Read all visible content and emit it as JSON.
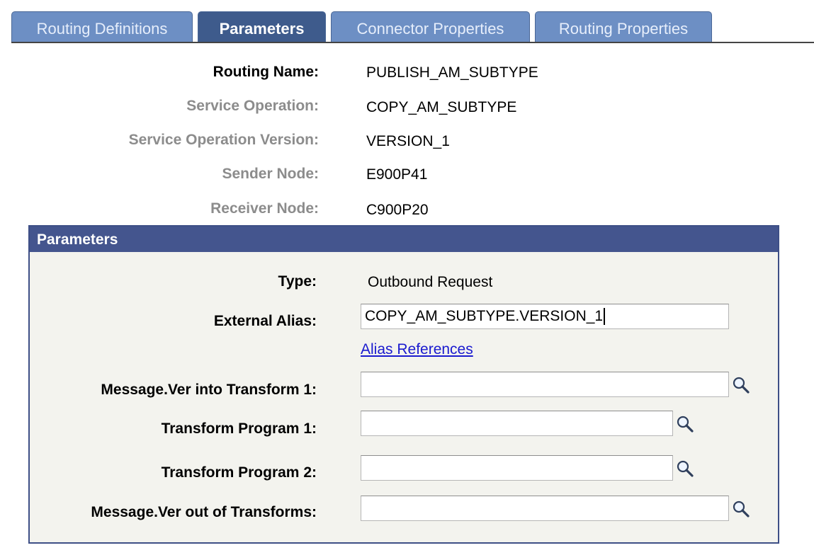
{
  "tabs": [
    {
      "label": "Routing Definitions"
    },
    {
      "label": "Parameters"
    },
    {
      "label": "Connector Properties"
    },
    {
      "label": "Routing Properties"
    }
  ],
  "active_tab": "Parameters",
  "header": {
    "routing_name_label": "Routing Name:",
    "routing_name": "PUBLISH_AM_SUBTYPE",
    "service_operation_label": "Service Operation:",
    "service_operation": "COPY_AM_SUBTYPE",
    "service_operation_version_label": "Service Operation Version:",
    "service_operation_version": "VERSION_1",
    "sender_node_label": "Sender Node:",
    "sender_node": "E900P41",
    "receiver_node_label": "Receiver Node:",
    "receiver_node": "C900P20"
  },
  "parameters": {
    "title": "Parameters",
    "type_label": "Type:",
    "type_value": "Outbound Request",
    "external_alias_label": "External Alias:",
    "external_alias_value": "COPY_AM_SUBTYPE.VERSION_1",
    "alias_references_link": "Alias References",
    "msg_into_transform_label": "Message.Ver into Transform 1:",
    "msg_into_transform_value": "",
    "transform_program_1_label": "Transform Program 1:",
    "transform_program_1_value": "",
    "transform_program_2_label": "Transform Program 2:",
    "transform_program_2_value": "",
    "msg_out_of_transforms_label": "Message.Ver out of Transforms:",
    "msg_out_of_transforms_value": ""
  },
  "icons": {
    "lookup": "magnifier-icon"
  }
}
